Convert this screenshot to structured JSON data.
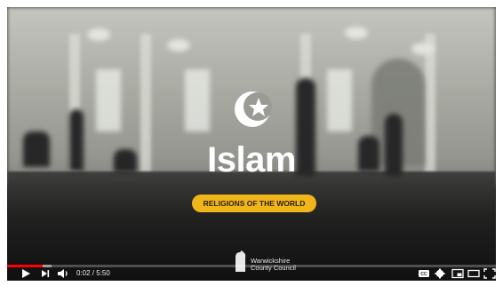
{
  "video": {
    "title": "Islam",
    "subtitle": "RELIGIONS OF THE WORLD",
    "brand_line1": "Warwickshire",
    "brand_line2": "County Council",
    "played_fraction": 0.0061,
    "loaded_fraction": 0.09
  },
  "controls": {
    "time_display": "0:02 / 5:50",
    "icons": [
      "play-icon",
      "next-icon",
      "volume-icon",
      "subtitles-icon",
      "settings-icon",
      "miniplayer-icon",
      "theater-icon",
      "fullscreen-icon"
    ]
  },
  "colors": {
    "accent": "#f1b51c",
    "progress": "#ff0000"
  }
}
